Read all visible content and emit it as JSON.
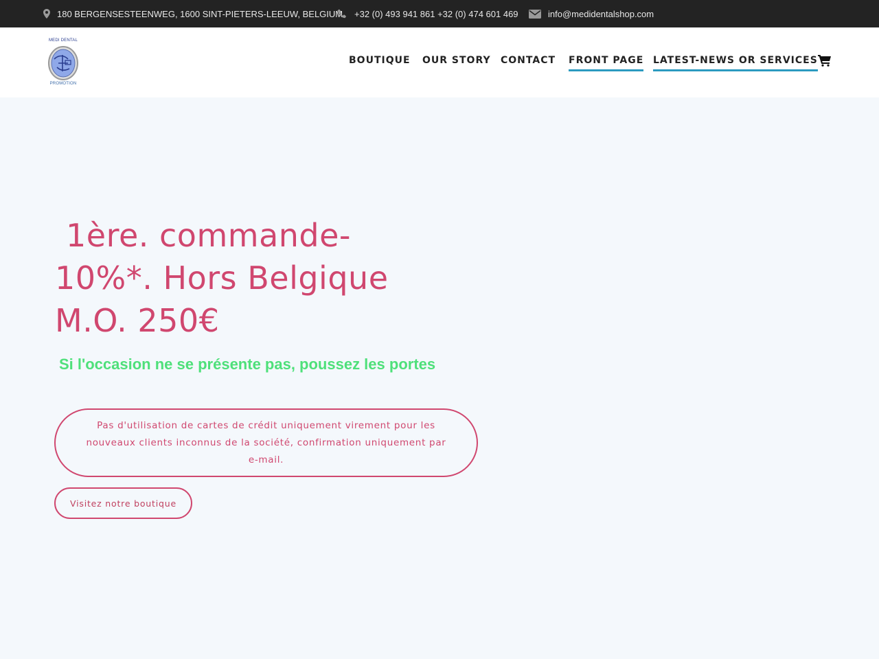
{
  "topbar": {
    "address": "180 BERGENSESTEENWEG, 1600 SINT-PIETERS-LEEUW, BELGIUM",
    "phone": "+32 (0) 493 941 861 +32 (0) 474 601 469",
    "email": "info@medidentalshop.com",
    "background": "#232323"
  },
  "logo": {
    "top_text": "MEDI DENTAL",
    "bottom_text": "PROMOTION"
  },
  "nav": {
    "items": [
      {
        "label": "BOUTIQUE",
        "active": false
      },
      {
        "label": "OUR STORY",
        "active": false
      },
      {
        "label": "CONTACT",
        "active": false
      },
      {
        "label": "FRONT PAGE",
        "active": true
      },
      {
        "label": "LATEST-NEWS OR SERVICES",
        "active": true
      }
    ],
    "cart_icon": "shopping-cart-icon",
    "active_underline_color": "#2b9ac0"
  },
  "hero": {
    "title_line1": "1ère. commande-",
    "title_line2": "10%*. Hors Belgique",
    "title_line3": "M.O. 250€",
    "subtitle": "Si l'occasion ne se présente pas, poussez les portes",
    "notice": "Pas d'utilisation de cartes de crédit uniquement virement pour les nouveaux clients inconnus de la société, confirmation uniquement par e-mail.",
    "button_label": "Visitez notre boutique",
    "accent_color": "#d0476f",
    "subtitle_color": "#4ee07a"
  }
}
